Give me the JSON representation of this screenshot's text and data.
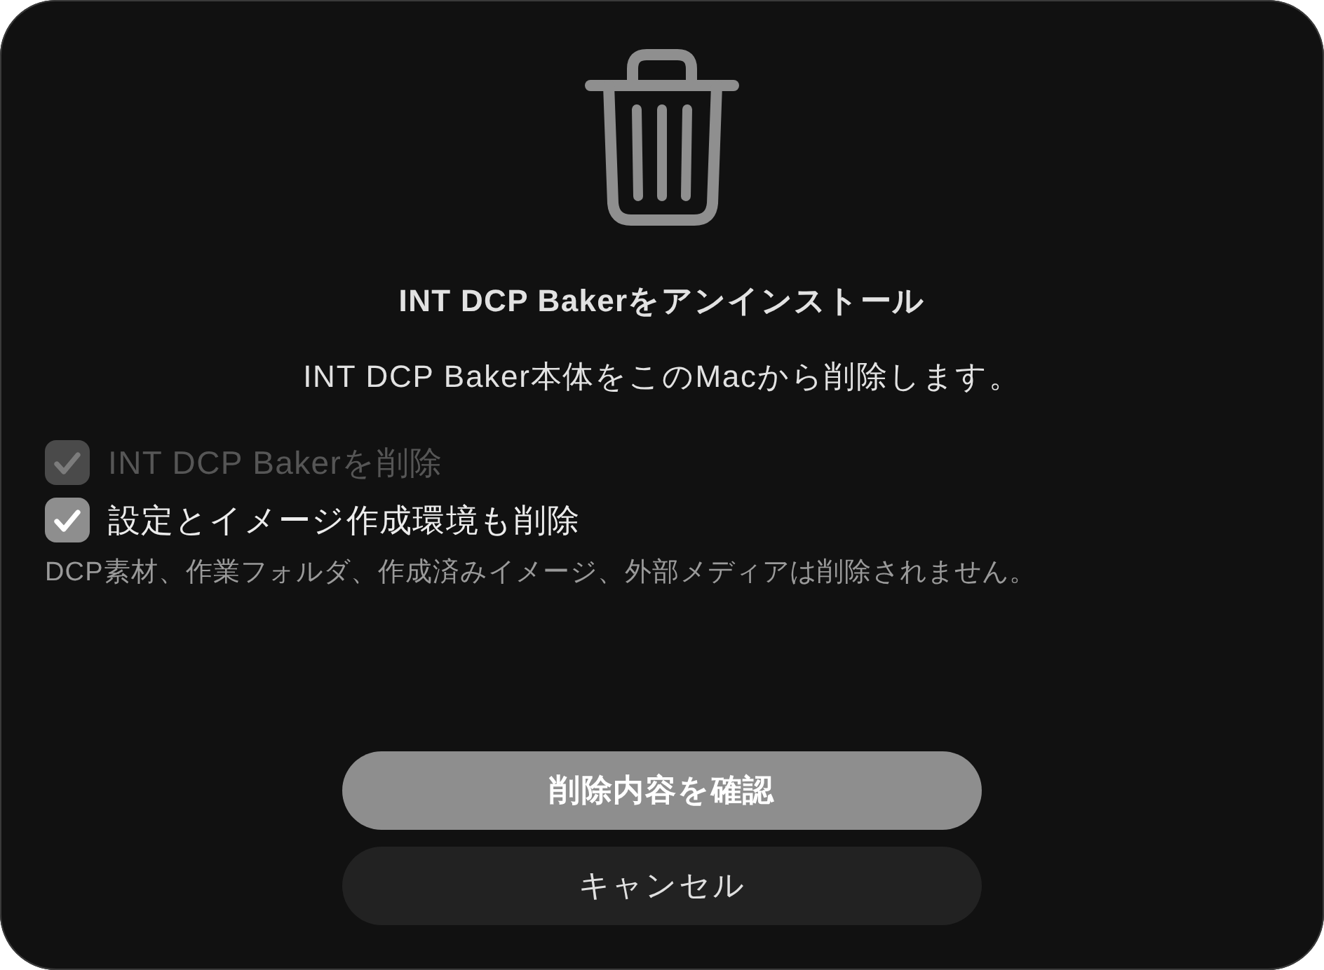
{
  "title": "INT DCP Bakerをアンインストール",
  "message": "INT DCP Baker本体をこのMacから削除します。",
  "options": [
    {
      "label": "INT DCP Bakerを削除",
      "checked": true,
      "disabled": true
    },
    {
      "label": "設定とイメージ作成環境も削除",
      "checked": true,
      "disabled": false
    }
  ],
  "note": "DCP素材、作業フォルダ、作成済みイメージ、外部メディアは削除されません。",
  "buttons": [
    {
      "label": "削除内容を確認",
      "kind": "primary"
    },
    {
      "label": "キャンセル",
      "kind": "secondary"
    }
  ]
}
